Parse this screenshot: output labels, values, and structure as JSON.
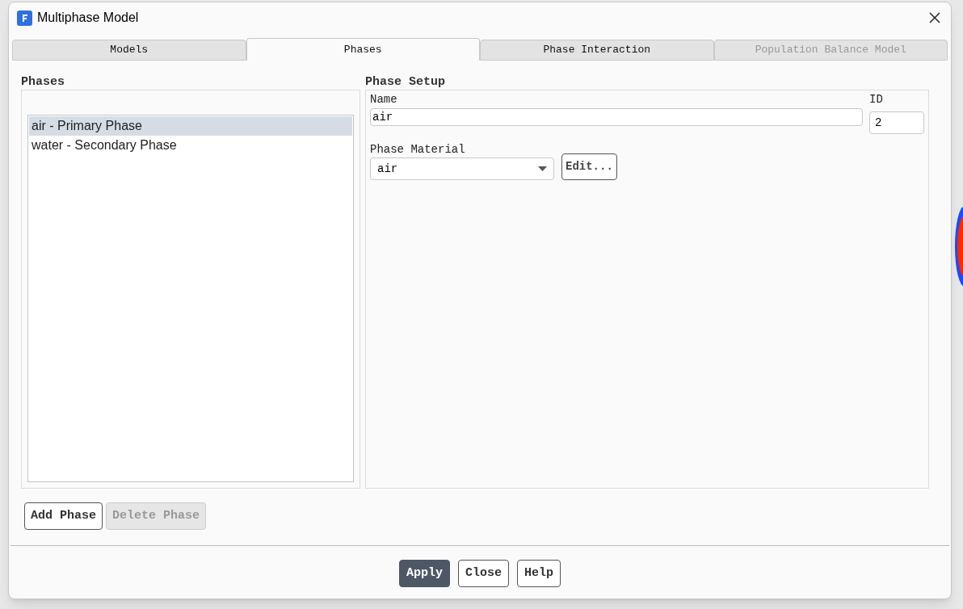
{
  "window": {
    "title": "Multiphase Model"
  },
  "tabs": [
    {
      "label": "Models",
      "selected": false,
      "disabled": false
    },
    {
      "label": "Phases",
      "selected": true,
      "disabled": false
    },
    {
      "label": "Phase Interaction",
      "selected": false,
      "disabled": false
    },
    {
      "label": "Population Balance Model",
      "selected": false,
      "disabled": true
    }
  ],
  "phases": {
    "title": "Phases",
    "items": [
      {
        "label": "air - Primary Phase",
        "selected": true
      },
      {
        "label": "water - Secondary Phase",
        "selected": false
      }
    ],
    "buttons": [
      {
        "label": "Add Phase",
        "disabled": false
      },
      {
        "label": "Delete Phase",
        "disabled": true
      }
    ]
  },
  "phase_setup": {
    "title": "Phase Setup",
    "name_label": "Name",
    "name_value": "air",
    "id_label": "ID",
    "id_value": "2",
    "material_label": "Phase Material",
    "material_value": "air",
    "edit_button": "Edit..."
  },
  "footer_buttons": [
    {
      "label": "Apply",
      "kind": "primary"
    },
    {
      "label": "Close",
      "kind": "normal"
    },
    {
      "label": "Help",
      "kind": "normal"
    }
  ]
}
